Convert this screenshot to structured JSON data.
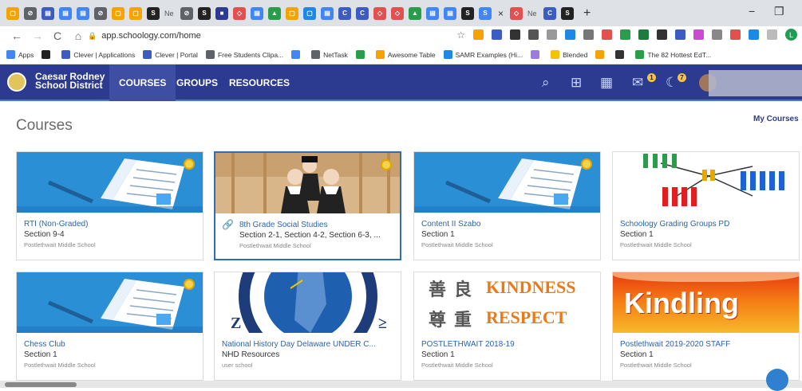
{
  "browser": {
    "tabs": [
      {
        "icon": "schoology-icon",
        "color": "#f4a300",
        "glyph": "▢"
      },
      {
        "icon": "globe-icon",
        "color": "#5f6368",
        "glyph": "⊘"
      },
      {
        "icon": "classroom-icon",
        "color": "#3c5cc2",
        "glyph": "▤"
      },
      {
        "icon": "docs-icon",
        "color": "#4285f4",
        "glyph": "▤"
      },
      {
        "icon": "docs-icon",
        "color": "#4285f4",
        "glyph": "▤"
      },
      {
        "icon": "globe-icon",
        "color": "#5f6368",
        "glyph": "⊘"
      },
      {
        "icon": "schoology-icon",
        "color": "#f4a300",
        "glyph": "▢"
      },
      {
        "icon": "schoology-icon",
        "color": "#f4a300",
        "glyph": "▢"
      },
      {
        "icon": "s-icon",
        "color": "#222",
        "glyph": "S"
      },
      {
        "icon": "ne-label",
        "color": "#dee1e6",
        "glyph": "Ne",
        "text": true
      },
      {
        "icon": "globe-icon",
        "color": "#5f6368",
        "glyph": "⊘"
      },
      {
        "icon": "s-icon",
        "color": "#222",
        "glyph": "S"
      },
      {
        "icon": "app-icon",
        "color": "#2c3a8f",
        "glyph": "■"
      },
      {
        "icon": "diamond-icon",
        "color": "#e25050",
        "glyph": "◇"
      },
      {
        "icon": "docs-icon",
        "color": "#4285f4",
        "glyph": "▤"
      },
      {
        "icon": "drive-icon",
        "color": "#2a9d4b",
        "glyph": "▲"
      },
      {
        "icon": "schoology-icon",
        "color": "#f4a300",
        "glyph": "▢"
      },
      {
        "icon": "meet-icon",
        "color": "#1e88e5",
        "glyph": "▢"
      },
      {
        "icon": "docs-icon",
        "color": "#4285f4",
        "glyph": "▤"
      },
      {
        "icon": "c-icon",
        "color": "#3c5cc2",
        "glyph": "C"
      },
      {
        "icon": "c-icon",
        "color": "#3c5cc2",
        "glyph": "C"
      },
      {
        "icon": "diamond-icon",
        "color": "#e25050",
        "glyph": "◇"
      },
      {
        "icon": "diamond-icon",
        "color": "#e25050",
        "glyph": "◇"
      },
      {
        "icon": "drive-icon",
        "color": "#2a9d4b",
        "glyph": "▲"
      },
      {
        "icon": "docs-icon",
        "color": "#4285f4",
        "glyph": "▤"
      },
      {
        "icon": "docs-icon",
        "color": "#4285f4",
        "glyph": "▤"
      },
      {
        "icon": "s-icon",
        "color": "#222",
        "glyph": "S"
      },
      {
        "icon": "s-icon",
        "color": "#4285f4",
        "glyph": "S"
      }
    ],
    "active_tab_close": "×",
    "after_tabs": [
      {
        "icon": "diamond-icon",
        "color": "#e25050",
        "glyph": "◇"
      },
      {
        "icon": "ne-label",
        "color": "#dee1e6",
        "glyph": "Ne",
        "text": true
      },
      {
        "icon": "c-icon",
        "color": "#3c5cc2",
        "glyph": "C"
      },
      {
        "icon": "s-icon",
        "color": "#222",
        "glyph": "S"
      }
    ],
    "new_tab": "+",
    "minimize": "−",
    "restore": "❐",
    "url": "app.schoology.com/home",
    "bookmarks": [
      {
        "label": "Apps",
        "color": "#4285f4"
      },
      {
        "label": "",
        "color": "#222"
      },
      {
        "label": "Clever | Applications",
        "color": "#3c5cc2"
      },
      {
        "label": "Clever | Portal",
        "color": "#3c5cc2"
      },
      {
        "label": "Free Students Clipa...",
        "color": "#5f6368"
      },
      {
        "label": "",
        "color": "#4285f4"
      },
      {
        "label": "NetTask",
        "color": "#5f6368"
      },
      {
        "label": "",
        "color": "#2a9d4b"
      },
      {
        "label": "Awesome Table",
        "color": "#f4a300"
      },
      {
        "label": "SAMR Examples (Hi...",
        "color": "#1e88e5"
      },
      {
        "label": "",
        "color": "#9a7be3"
      },
      {
        "label": "Blended",
        "color": "#f4c300"
      },
      {
        "label": "",
        "color": "#f4a300"
      },
      {
        "label": "",
        "color": "#333"
      },
      {
        "label": "The 82 Hottest EdT...",
        "color": "#2a9d4b"
      }
    ]
  },
  "header": {
    "district_line1": "Caesar Rodney",
    "district_line2": "School District",
    "nav": [
      "COURSES",
      "GROUPS",
      "RESOURCES"
    ],
    "messages_badge": "1",
    "notifications_badge": "7"
  },
  "page": {
    "title": "Courses",
    "my_courses_link": "My Courses"
  },
  "courses": [
    {
      "title": "RTI (Non-Graded)",
      "section": "Section 9-4",
      "school": "Postlethwait Middle School",
      "banner": "notebook",
      "badge": true
    },
    {
      "title": "8th Grade Social Studies",
      "section": "Section 2-1, Section 4-2, Section 6-3, ...",
      "school": "Postlethwait Middle School",
      "banner": "photo",
      "badge": true,
      "linked": true,
      "selected": true
    },
    {
      "title": "Content II Szabo",
      "section": "Section 1",
      "school": "Postlethwait Middle School",
      "banner": "notebook",
      "badge": true
    },
    {
      "title": "Schoology Grading Groups PD",
      "section": "Section 1",
      "school": "Postlethwait Middle School",
      "banner": "groups",
      "badge": false
    },
    {
      "title": "Chess Club",
      "section": "Section 1",
      "school": "Postlethwait Middle School",
      "banner": "notebook",
      "badge": true
    },
    {
      "title": "National History Day Delaware UNDER C...",
      "section": "NHD Resources",
      "school": "user school",
      "banner": "seal",
      "badge": false
    },
    {
      "title": "POSTLETHWAIT 2018-19",
      "section": "Section 1",
      "school": "Postlethwait Middle School",
      "banner": "kindness",
      "badge": false,
      "banner_text": [
        "善",
        "良",
        "KINDNESS",
        "尊",
        "重",
        "RESPECT"
      ]
    },
    {
      "title": "Postlethwait 2019-2020 STAFF",
      "section": "Section 1",
      "school": "Postlethwait Middle School",
      "banner": "kindling",
      "badge": false,
      "banner_text": [
        "Kindling"
      ]
    }
  ]
}
